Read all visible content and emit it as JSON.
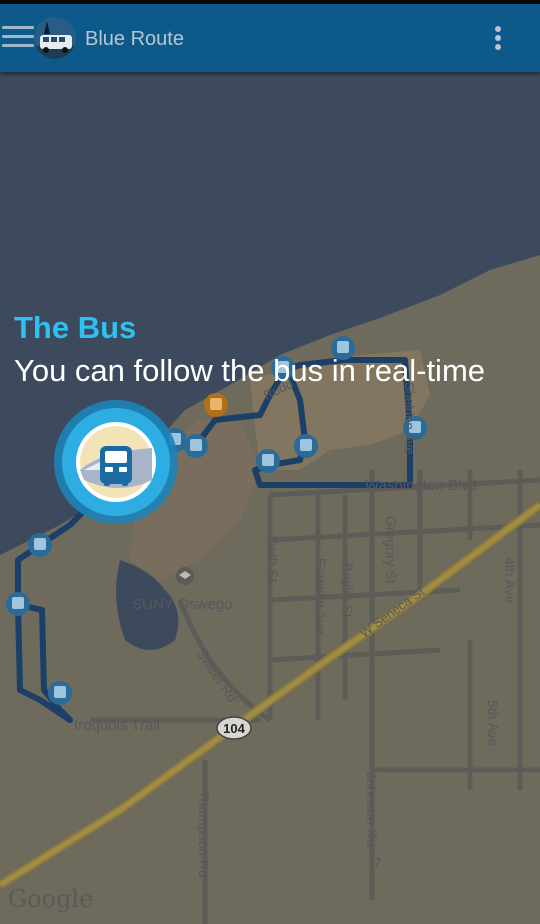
{
  "toolbar": {
    "title": "Blue Route",
    "menu_icon": "hamburger-menu-icon",
    "overflow_icon": "more-vert-icon"
  },
  "coach_mark": {
    "title": "The Bus",
    "body": "You can follow the bus in real-time"
  },
  "map": {
    "labels": {
      "washington": "Washington Blvd",
      "suny": "SUNY Oswego",
      "swift": "Swift St",
      "franklin": "Franklin Ave",
      "baylis": "Baylis St",
      "gregory": "Gregory St",
      "ave4": "4th Ave",
      "ave5": "5th Ave",
      "seneca": "W Seneca St",
      "sweet": "Sweet Rd",
      "iroquois": "Iroquois Trail",
      "thompson": "Thompson Rd",
      "johnson": "Johnson Rd",
      "route104": "104",
      "road_partial": "Rudd",
      "sheldon_partial": "Sheldon Ave",
      "seven": "7",
      "attribution": "Google"
    }
  },
  "colors": {
    "toolbar": "#0d5a8a",
    "route": "#1b3f66",
    "coach_title": "#2ec0f0",
    "land": "#6e6a5c",
    "water": "#3d4a5e"
  }
}
